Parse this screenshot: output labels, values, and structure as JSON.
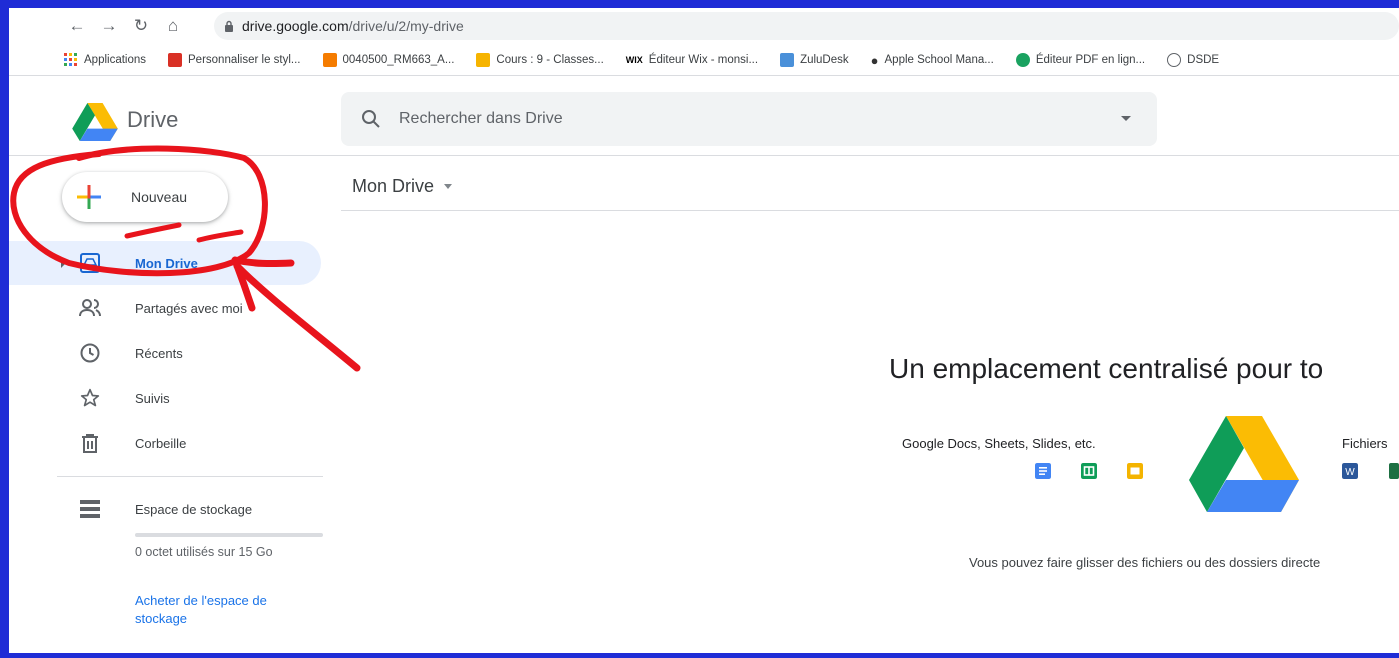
{
  "browser": {
    "url_host": "drive.google.com",
    "url_path": "/drive/u/2/my-drive",
    "bookmarks": [
      {
        "label": "Applications",
        "color": "#e94235"
      },
      {
        "label": "Personnaliser le styl...",
        "color": "#d93025"
      },
      {
        "label": "0040500_RM663_A...",
        "color": "#f57c00"
      },
      {
        "label": "Cours : 9 - Classes...",
        "color": "#f6b400"
      },
      {
        "label": "Éditeur Wix - monsi...",
        "color": "#000000"
      },
      {
        "label": "ZuluDesk",
        "color": "#4a90d9"
      },
      {
        "label": "Apple School Mana...",
        "color": "#333333"
      },
      {
        "label": "Éditeur PDF en lign...",
        "color": "#1aa260"
      },
      {
        "label": "DSDE",
        "color": "#5f6368"
      }
    ],
    "bookmark_wix_mark": "WIX"
  },
  "header": {
    "title": "Drive",
    "search_placeholder": "Rechercher dans Drive"
  },
  "sidebar": {
    "new_label": "Nouveau",
    "items": [
      {
        "label": "Mon Drive",
        "icon": "my-drive-icon",
        "active": true
      },
      {
        "label": "Partagés avec moi",
        "icon": "shared-people-icon"
      },
      {
        "label": "Récents",
        "icon": "clock-icon"
      },
      {
        "label": "Suivis",
        "icon": "star-icon"
      },
      {
        "label": "Corbeille",
        "icon": "trash-icon"
      }
    ],
    "storage_label": "Espace de stockage",
    "storage_used": "0 octet utilisés sur 15 Go",
    "buy_storage": "Acheter de l'espace de stockage",
    "storage_fill": 0
  },
  "main": {
    "breadcrumb": "Mon Drive",
    "hero_title": "Un emplacement centralisé pour to",
    "col1_label": "Google Docs, Sheets, Slides, etc.",
    "col2_label": "Fichiers",
    "drop_hint": "Vous pouvez faire glisser des fichiers ou des dossiers directe",
    "word_mark": "W"
  },
  "colors": {
    "frame_border": "#1f2cd6",
    "accent": "#1a73e8",
    "active_bg": "#e8f0fe",
    "annotation_red": "#e8141c"
  }
}
